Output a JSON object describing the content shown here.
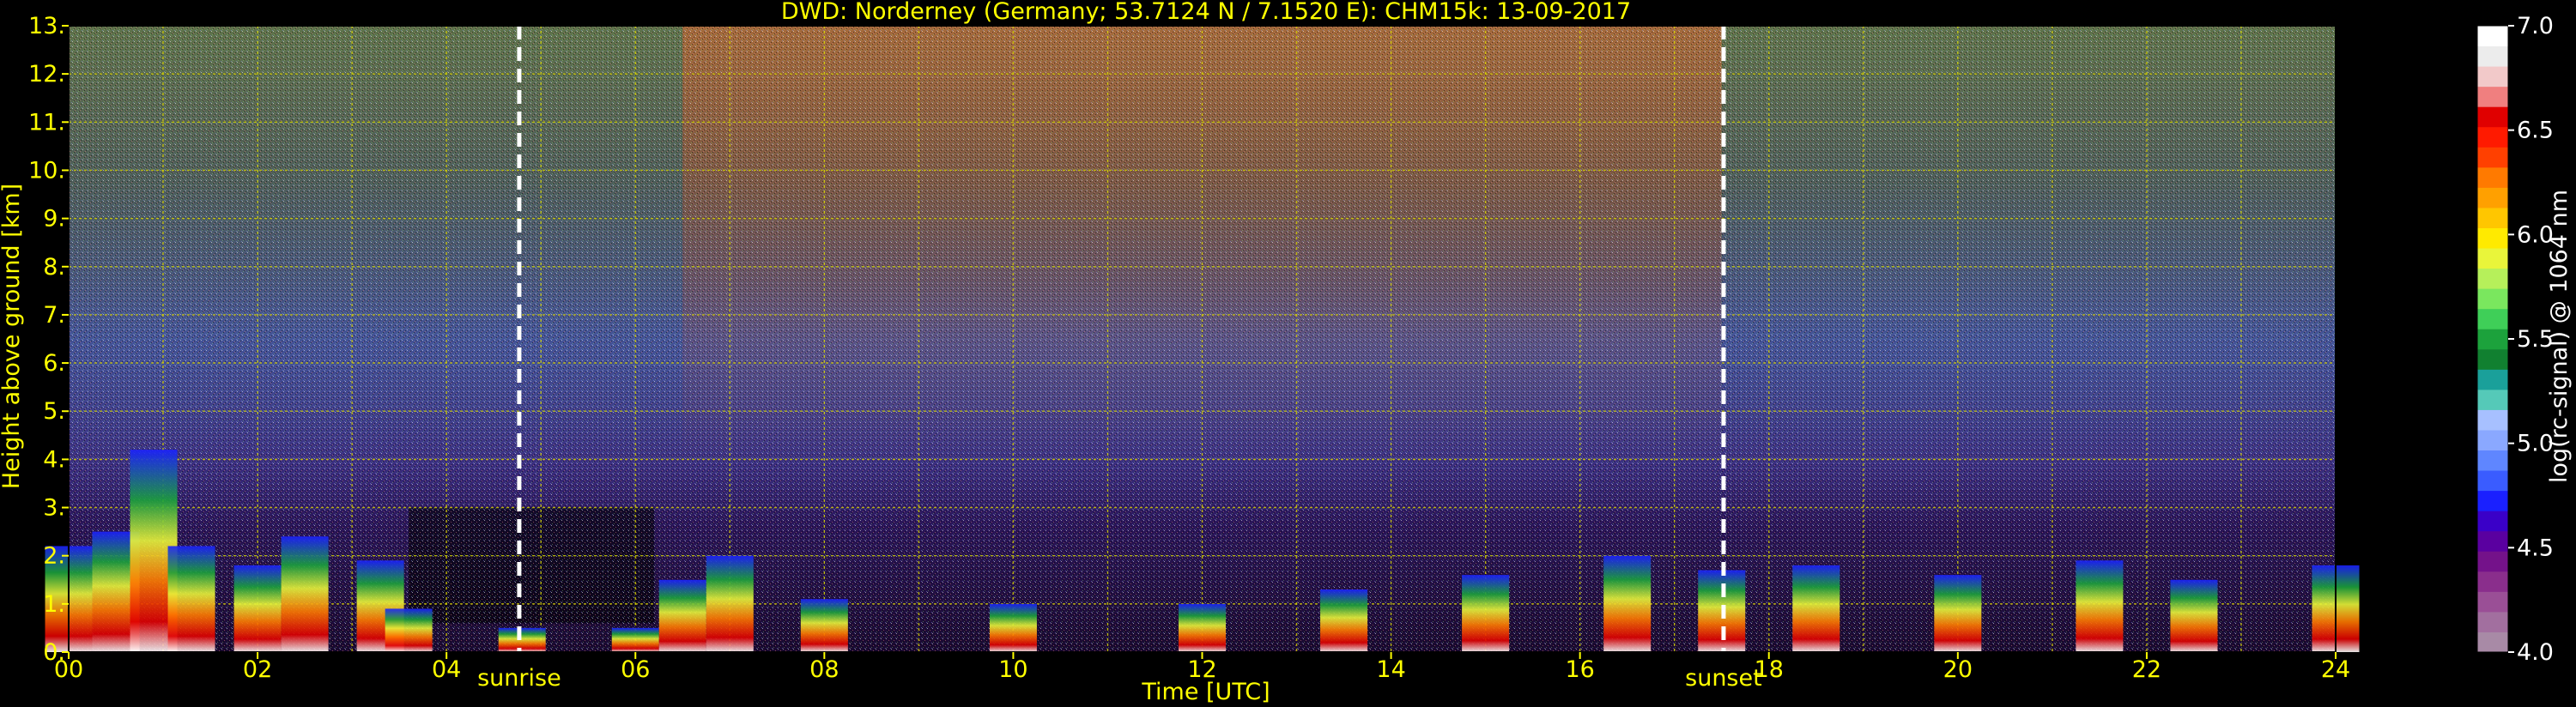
{
  "chart_data": {
    "type": "heatmap",
    "title": "DWD: Norderney (Germany; 53.7124 N / 7.1520 E):    CHM15k: 13-09-2017",
    "xlabel": "Time [UTC]",
    "ylabel": "Height above ground [km]",
    "xlim": [
      0,
      24
    ],
    "ylim": [
      0,
      13
    ],
    "x_ticks": [
      "00",
      "02",
      "04",
      "06",
      "08",
      "10",
      "12",
      "14",
      "16",
      "18",
      "20",
      "22",
      "24"
    ],
    "y_ticks": [
      "0.",
      "1.",
      "2.",
      "3.",
      "4.",
      "5.",
      "6.",
      "7.",
      "8.",
      "9.",
      "10.",
      "11.",
      "12.",
      "13."
    ],
    "grid": true,
    "colorbar": {
      "label": "log(rc-signal) @ 1064 nm",
      "range": [
        4.0,
        7.0
      ],
      "ticks": [
        "4.0",
        "4.5",
        "5.0",
        "5.5",
        "6.0",
        "6.5",
        "7.0"
      ],
      "colors": [
        "#a88aa6",
        "#a26f9f",
        "#9a4f96",
        "#8a2e8c",
        "#74128a",
        "#5a00a0",
        "#3a00c8",
        "#1a20ff",
        "#3a5cff",
        "#5f86ff",
        "#8aa8ff",
        "#a7c0ff",
        "#55c9b8",
        "#1aa09a",
        "#118030",
        "#1ca23c",
        "#3fcf58",
        "#7ae75e",
        "#b6f05a",
        "#e9f53a",
        "#ffea00",
        "#ffc600",
        "#ffa000",
        "#ff7a00",
        "#ff4000",
        "#ff1a00",
        "#e00000",
        "#f07f7f",
        "#f2c9c9",
        "#ececec",
        "#ffffff"
      ]
    },
    "annotations": [
      {
        "text": "sunrise",
        "x": 4.77
      },
      {
        "text": "sunset",
        "x": 17.52
      }
    ],
    "cloud_base_height_km": [
      {
        "x": 0.0,
        "y": 2.2
      },
      {
        "x": 0.5,
        "y": 2.5
      },
      {
        "x": 0.9,
        "y": 4.2
      },
      {
        "x": 1.3,
        "y": 2.2
      },
      {
        "x": 2.0,
        "y": 1.8
      },
      {
        "x": 2.5,
        "y": 2.4
      },
      {
        "x": 3.3,
        "y": 1.9
      },
      {
        "x": 3.6,
        "y": 0.9
      },
      {
        "x": 4.8,
        "y": 0.5
      },
      {
        "x": 6.0,
        "y": 0.5
      },
      {
        "x": 6.5,
        "y": 1.5
      },
      {
        "x": 7.0,
        "y": 2.0
      },
      {
        "x": 8.0,
        "y": 1.1
      },
      {
        "x": 10.0,
        "y": 1.0
      },
      {
        "x": 12.0,
        "y": 1.0
      },
      {
        "x": 13.5,
        "y": 1.3
      },
      {
        "x": 15.0,
        "y": 1.6
      },
      {
        "x": 16.5,
        "y": 2.0
      },
      {
        "x": 17.5,
        "y": 1.7
      },
      {
        "x": 18.5,
        "y": 1.8
      },
      {
        "x": 20.0,
        "y": 1.6
      },
      {
        "x": 21.5,
        "y": 1.9
      },
      {
        "x": 22.5,
        "y": 1.5
      },
      {
        "x": 24.0,
        "y": 1.8
      }
    ]
  }
}
